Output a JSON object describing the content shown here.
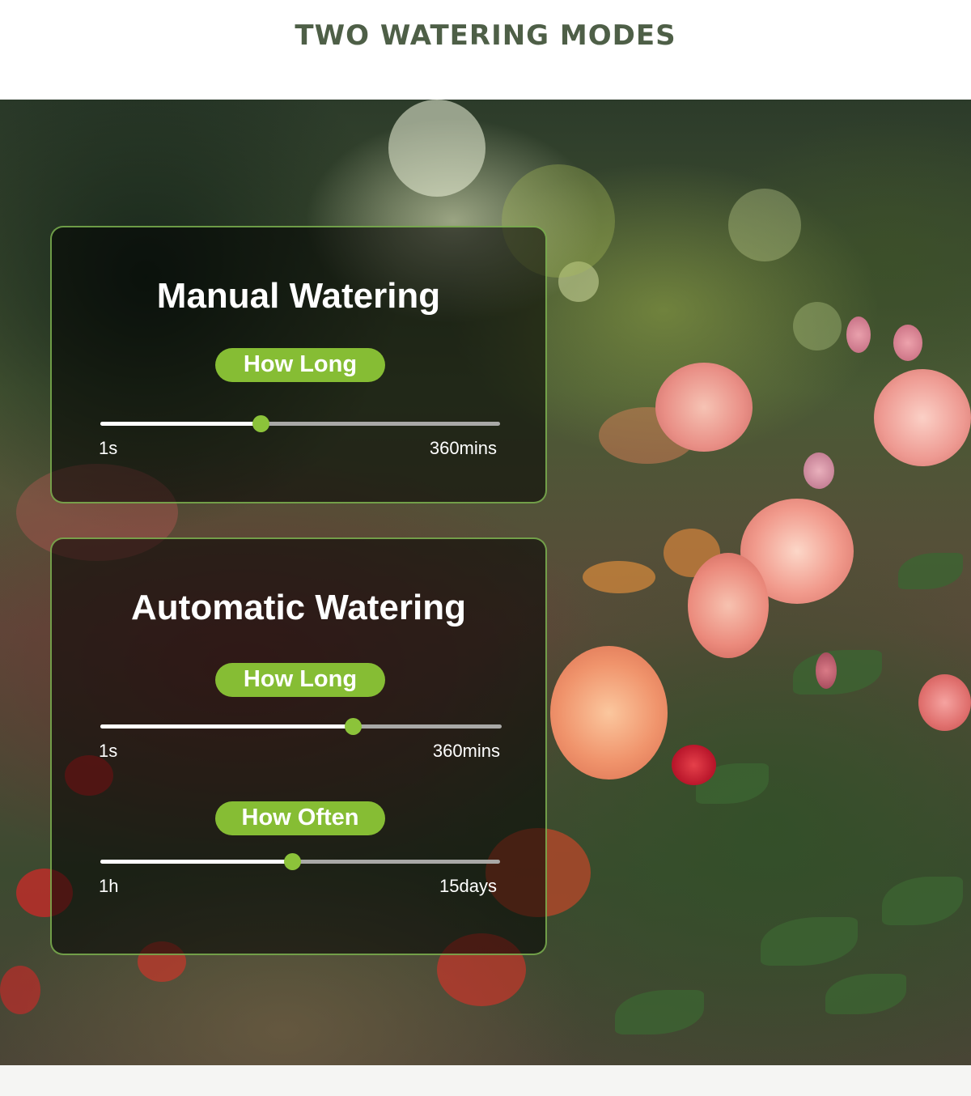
{
  "header": {
    "title": "TWO WATERING MODES"
  },
  "manual": {
    "title": "Manual Watering",
    "how_long": {
      "label": "How Long",
      "min_label": "1s",
      "max_label": "360mins",
      "value_fraction": 0.4
    }
  },
  "automatic": {
    "title": "Automatic Watering",
    "how_long": {
      "label": "How Long",
      "min_label": "1s",
      "max_label": "360mins",
      "value_fraction": 0.63
    },
    "how_often": {
      "label": "How Often",
      "min_label": "1h",
      "max_label": "15days",
      "value_fraction": 0.48
    }
  },
  "colors": {
    "accent": "#86bd34",
    "title": "#4e5f47",
    "panel_border": "#8cc85a"
  },
  "background": {
    "description_icon": "rose-garden-photo"
  }
}
